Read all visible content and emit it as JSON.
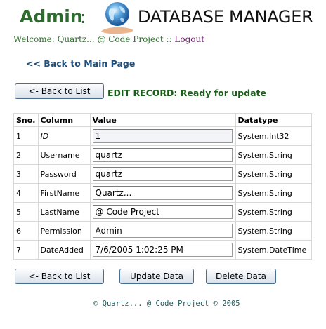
{
  "header": {
    "admin": "Admin",
    "colon": ":",
    "title": "DATABASE MANAGER",
    "logo_icon": "globe-in-hand-icon"
  },
  "welcome": {
    "text": "Welcome: Quartz... @ Code Project :: ",
    "logout": "Logout"
  },
  "back_main": "<< Back to Main Page",
  "top_button": "<- Back to List",
  "status": "EDIT RECORD: Ready for update",
  "table": {
    "headers": [
      "Sno.",
      "Column",
      "Value",
      "Datatype"
    ],
    "rows": [
      {
        "sno": "1",
        "column": "ID",
        "value": "1",
        "type": "System.Int32"
      },
      {
        "sno": "2",
        "column": "Username",
        "value": "quartz",
        "type": "System.String"
      },
      {
        "sno": "3",
        "column": "Password",
        "value": "quartz",
        "type": "System.String"
      },
      {
        "sno": "4",
        "column": "FirstName",
        "value": "Quartz...",
        "type": "System.String"
      },
      {
        "sno": "5",
        "column": "LastName",
        "value": "@ Code Project",
        "type": "System.String"
      },
      {
        "sno": "6",
        "column": "Permission",
        "value": "Admin",
        "type": "System.String"
      },
      {
        "sno": "7",
        "column": "DateAdded",
        "value": "7/6/2005 1:02:25 PM",
        "type": "System.DateTime"
      }
    ]
  },
  "buttons": {
    "back": "<- Back to List",
    "update": "Update Data",
    "delete": "Delete Data"
  },
  "footer": "© Quartz... @ Code Project © 2005"
}
